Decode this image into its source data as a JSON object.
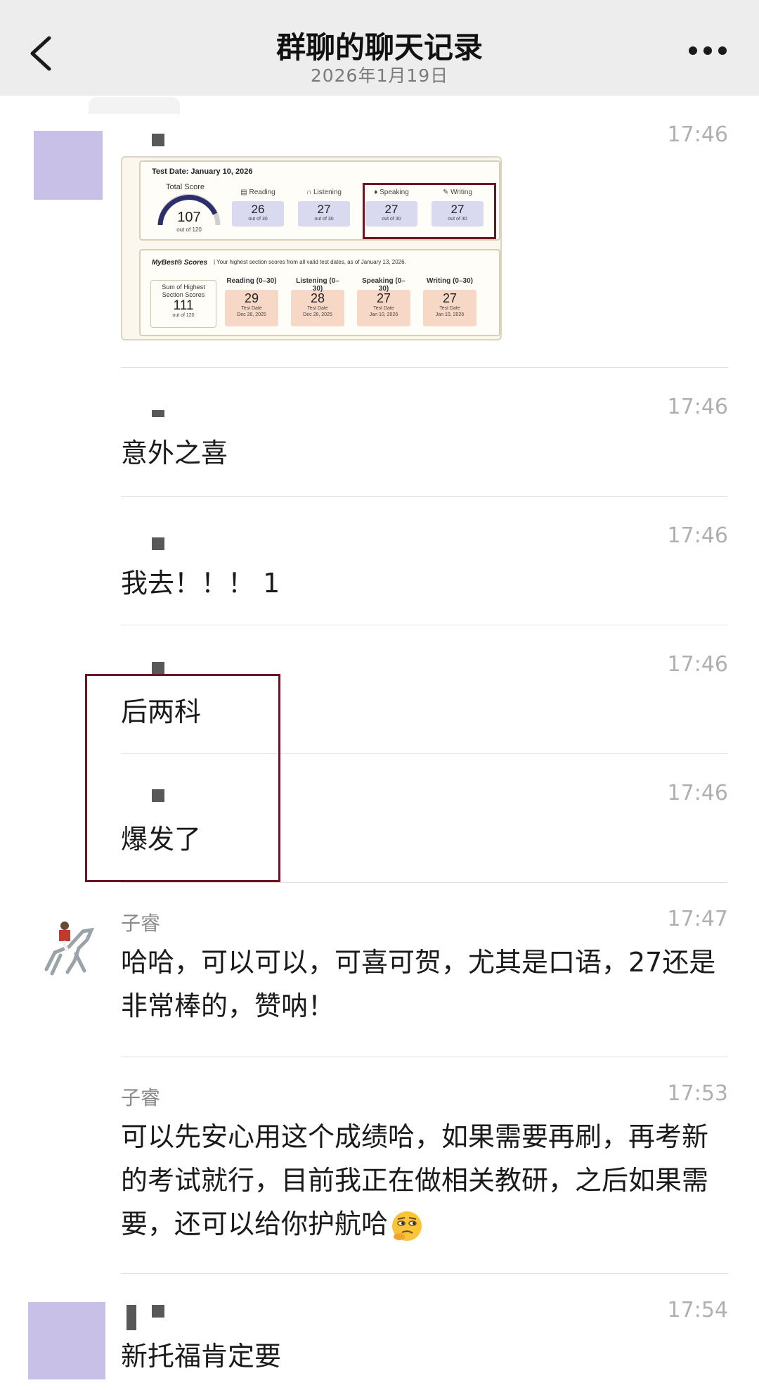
{
  "header": {
    "title": "群聊的聊天记录",
    "date": "2026年1月19日"
  },
  "score_card": {
    "test_date": "Test Date: January 10, 2026",
    "total_label": "Total Score",
    "total_value": "107",
    "total_sub": "out of 120",
    "sections": [
      {
        "label": "Reading",
        "value": "26",
        "sub": "out of 30"
      },
      {
        "label": "Listening",
        "value": "27",
        "sub": "out of 30"
      },
      {
        "label": "Speaking",
        "value": "27",
        "sub": "out of 30"
      },
      {
        "label": "Writing",
        "value": "27",
        "sub": "out of 30"
      }
    ],
    "mybest_title": "MyBest® Scores",
    "mybest_note": "|  Your highest section scores from all valid test dates, as of January 13, 2026.",
    "sum_label": "Sum of Highest Section Scores",
    "sum_value": "111",
    "sum_sub": "out of 120",
    "best": [
      {
        "label": "Reading (0–30)",
        "value": "29",
        "date_label": "Test Date",
        "date": "Dec 28, 2025"
      },
      {
        "label": "Listening (0–30)",
        "value": "28",
        "date_label": "Test Date",
        "date": "Dec 28, 2025"
      },
      {
        "label": "Speaking (0–30)",
        "value": "27",
        "date_label": "Test Date",
        "date": "Jan 10, 2026"
      },
      {
        "label": "Writing (0–30)",
        "value": "27",
        "date_label": "Test Date",
        "date": "Jan 10, 2026"
      }
    ]
  },
  "messages": [
    {
      "time": "17:46"
    },
    {
      "time": "17:46",
      "text": "意外之喜"
    },
    {
      "time": "17:46",
      "text": "我去！！！ 1"
    },
    {
      "time": "17:46",
      "text": "后两科"
    },
    {
      "time": "17:46",
      "text": "爆发了"
    },
    {
      "sender": "子睿",
      "time": "17:47",
      "text": "哈哈，可以可以，可喜可贺，尤其是口语，27还是非常棒的，赞呐！"
    },
    {
      "sender": "子睿",
      "time": "17:53",
      "text": "可以先安心用这个成绩哈，如果需要再刷，再考新的考试就行，目前我正在做相关教研，之后如果需要，还可以给你护航哈"
    },
    {
      "time": "17:54",
      "text": "新托福肯定要"
    }
  ],
  "colors": {
    "avatar": "#c8c0e6",
    "highlight": "#6b1525",
    "section_box": "#d9d9ef",
    "best_box": "#f7d8c6"
  },
  "icons": [
    "back-chevron-icon",
    "more-dots-icon",
    "thinking-face-emoji",
    "horse-rider-avatar"
  ]
}
